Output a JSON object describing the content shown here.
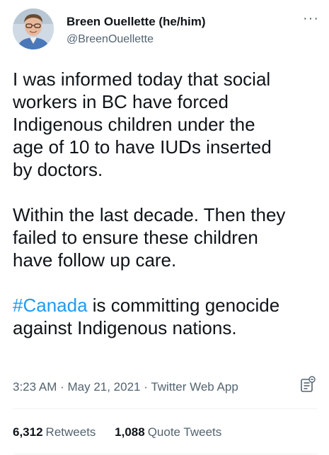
{
  "author": {
    "display_name": "Breen Ouellette (he/him)",
    "handle": "@BreenOuellette"
  },
  "more_icon": "more-horizontal-icon",
  "tweet": {
    "paragraph_1": "I was informed today that social\nworkers in BC have forced\nIndigenous children under the\nage of 10 to have IUDs inserted\nby doctors.",
    "paragraph_2": "Within the last decade. Then they\nfailed to ensure these children\nhave follow up care.",
    "hashtag": "#Canada",
    "paragraph_3_rest": " is committing genocide\nagainst Indigenous nations."
  },
  "meta": {
    "time": "3:23 AM",
    "separator_1": " · ",
    "date": "May 21, 2021",
    "separator_2": " · ",
    "source": "Twitter Web App"
  },
  "stats": {
    "retweets_count": "6,312",
    "retweets_label": "Retweets",
    "quotes_count": "1,088",
    "quotes_label": "Quote Tweets"
  },
  "colors": {
    "accent": "#1d9bf0",
    "text": "#0f1419",
    "secondary": "#536471"
  }
}
